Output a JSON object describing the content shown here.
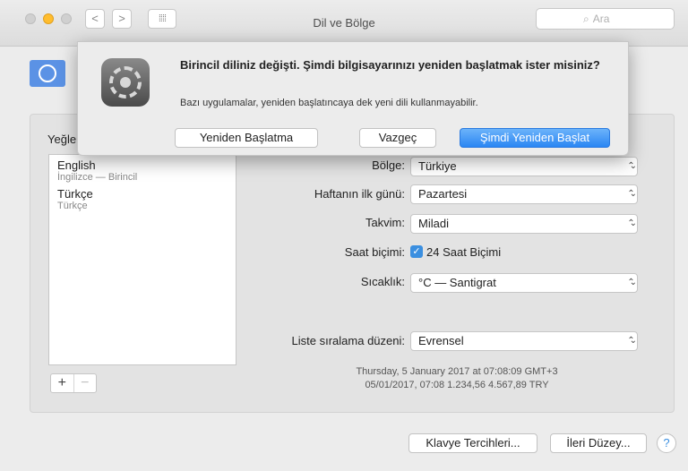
{
  "window": {
    "title": "Dil ve Bölge"
  },
  "toolbar": {
    "back_glyph": "<",
    "forward_glyph": ">",
    "grid_glyph": "⁞⁞⁞⁞",
    "search_placeholder": "Ara"
  },
  "panel": {
    "preferred_languages_label": "Yeğle",
    "languages": [
      {
        "name": "English",
        "subtitle": "İngilizce — Birincil"
      },
      {
        "name": "Türkçe",
        "subtitle": "Türkçe"
      }
    ],
    "add_glyph": "+",
    "remove_glyph": "−"
  },
  "settings": {
    "region": {
      "label": "Bölge:",
      "value": "Türkiye"
    },
    "first_day": {
      "label": "Haftanın ilk günü:",
      "value": "Pazartesi"
    },
    "calendar": {
      "label": "Takvim:",
      "value": "Miladi"
    },
    "time_format": {
      "label": "Saat biçimi:",
      "checkbox_label": "24 Saat Biçimi",
      "checked": true
    },
    "temperature": {
      "label": "Sıcaklık:",
      "value": "°C — Santigrat"
    },
    "sort_order": {
      "label": "Liste sıralama düzeni:",
      "value": "Evrensel"
    }
  },
  "sample": {
    "line1": "Thursday, 5 January 2017 at 07:08:09 GMT+3",
    "line2": "05/01/2017, 07:08   1.234,56   4.567,89 TRY"
  },
  "footer": {
    "keyboard_button": "Klavye Tercihleri...",
    "advanced_button": "İleri Düzey...",
    "help_glyph": "?"
  },
  "dialog": {
    "title": "Birincil diliniz değişti. Şimdi bilgisayarınızı yeniden başlatmak ister misiniz?",
    "message": "Bazı uygulamalar, yeniden başlatıncaya dek yeni dili kullanmayabilir.",
    "dont_restart": "Yeniden Başlatma",
    "cancel": "Vazgeç",
    "restart_now": "Şimdi Yeniden Başlat"
  },
  "colors": {
    "accent": "#2a86f3",
    "checkbox": "#3b8fe0",
    "flag": "#5b92e5"
  }
}
